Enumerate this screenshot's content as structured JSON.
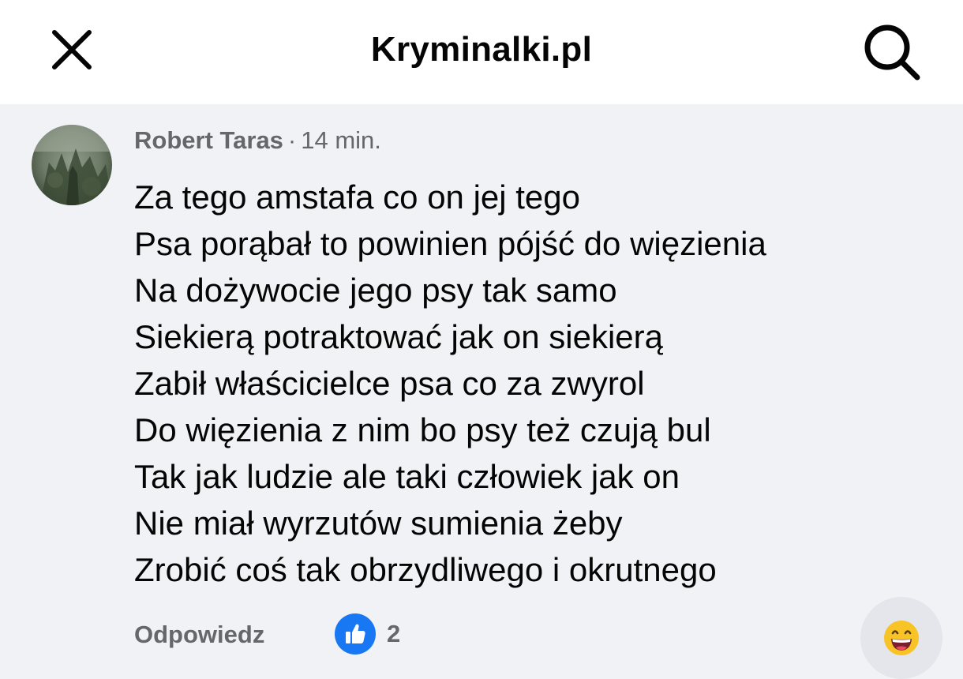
{
  "header": {
    "title": "Kryminalki.pl",
    "close_icon": "close-icon",
    "search_icon": "search-icon"
  },
  "comment": {
    "author": "Robert Taras",
    "separator": "·",
    "time": "14 min.",
    "lines": [
      "Za tego amstafa co on jej tego",
      "Psa porąbał to powinien pójść do więzienia",
      "Na dożywocie jego psy tak samo",
      "Siekierą potraktować jak on siekierą",
      "Zabił właścicielce psa co za zwyrol",
      "Do więzienia z nim bo psy też czują bul",
      "Tak jak ludzie ale taki człowiek jak on",
      "Nie miał wyrzutów sumienia żeby",
      "Zrobić coś tak obrzydliwego i okrutnego"
    ],
    "reply_label": "Odpowiedz",
    "like_count": "2",
    "like_icon": "thumbs-up-icon",
    "emoji_icon": "grinning-emoji-icon"
  },
  "colors": {
    "like_blue": "#1877f2",
    "comment_background": "#f0f2f5",
    "secondary_text": "#65676b"
  }
}
